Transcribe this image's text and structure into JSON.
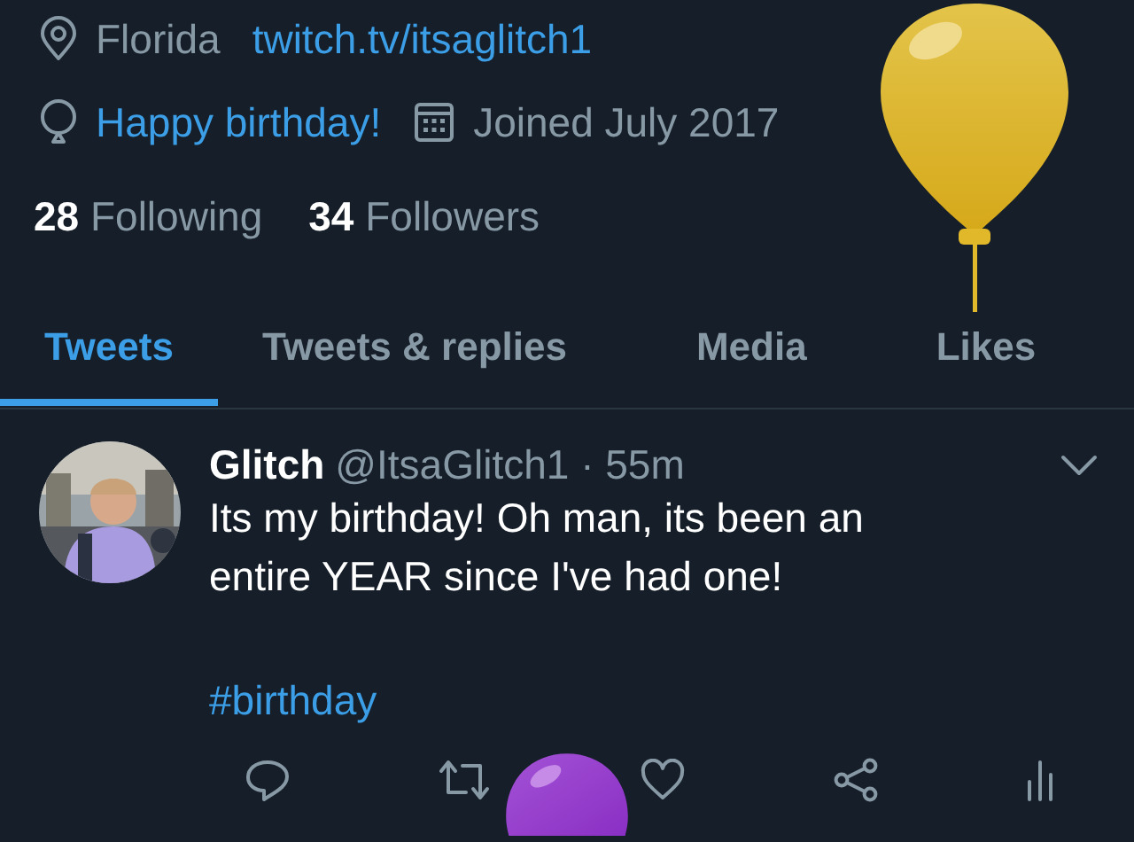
{
  "profile": {
    "location": "Florida",
    "link": "twitch.tv/itsaglitch1",
    "birthday": "Happy birthday!",
    "joined": "Joined July 2017",
    "stats": [
      {
        "count": "28",
        "label": "Following"
      },
      {
        "count": "34",
        "label": "Followers"
      }
    ]
  },
  "tabs": [
    {
      "label": "Tweets",
      "selected": true
    },
    {
      "label": "Tweets & replies",
      "selected": false
    },
    {
      "label": "Media",
      "selected": false
    },
    {
      "label": "Likes",
      "selected": false
    }
  ],
  "tweet": {
    "name": "Glitch",
    "meta": "@ItsaGlitch1 · 55m",
    "text": "Its my birthday! Oh man, its been an entire YEAR since I've had one!",
    "hashtag": "#birthday"
  }
}
